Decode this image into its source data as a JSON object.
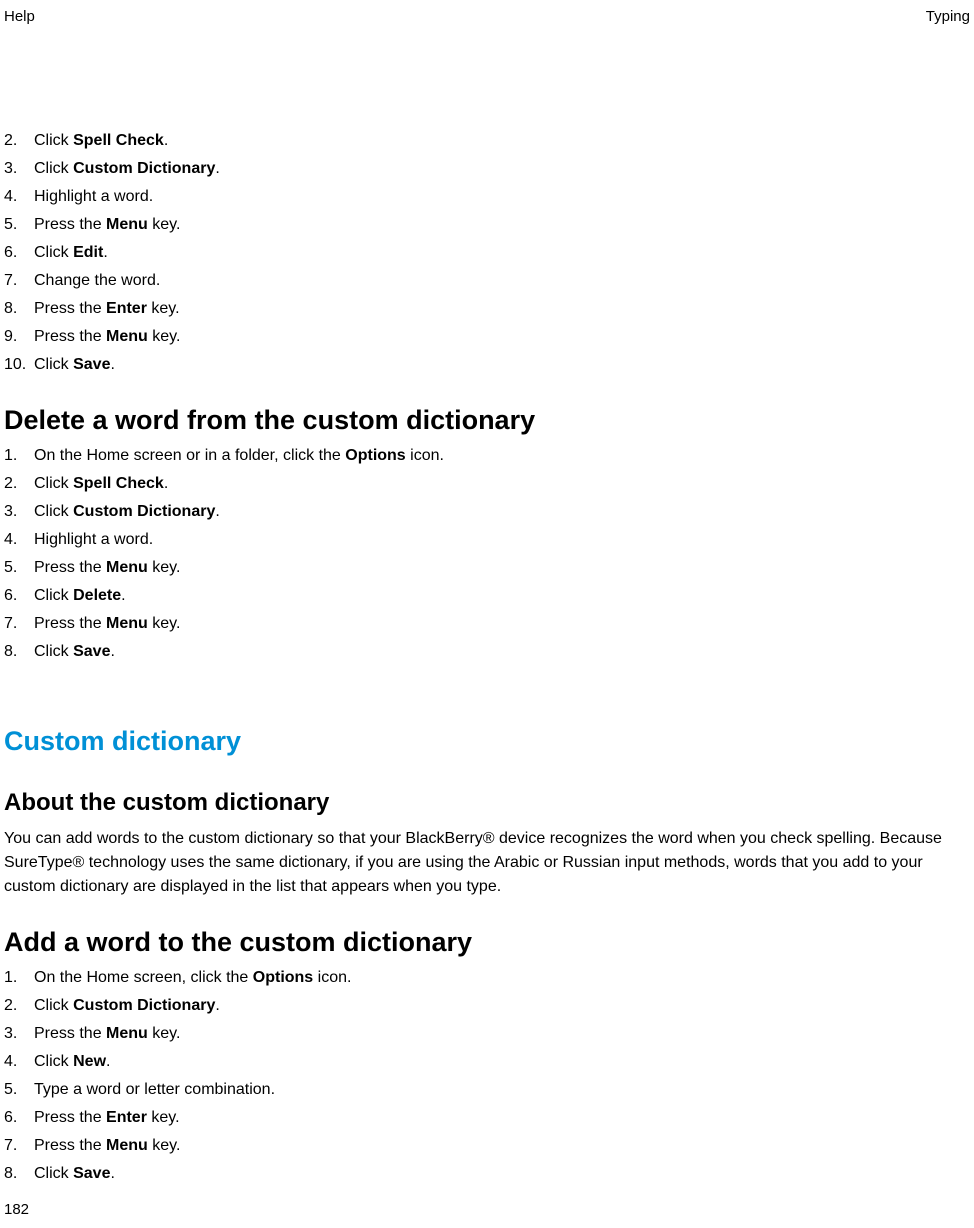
{
  "header": {
    "left": "Help",
    "right": "Typing"
  },
  "pageNumber": "182",
  "section1": {
    "steps": [
      {
        "n": "2.",
        "pre": "Click ",
        "bold": "Spell Check",
        "post": "."
      },
      {
        "n": "3.",
        "pre": "Click ",
        "bold": "Custom Dictionary",
        "post": "."
      },
      {
        "n": "4.",
        "pre": "Highlight a word.",
        "bold": "",
        "post": ""
      },
      {
        "n": "5.",
        "pre": "Press the ",
        "bold": "Menu",
        "post": " key."
      },
      {
        "n": "6.",
        "pre": "Click ",
        "bold": "Edit",
        "post": "."
      },
      {
        "n": "7.",
        "pre": "Change the word.",
        "bold": "",
        "post": ""
      },
      {
        "n": "8.",
        "pre": "Press the ",
        "bold": "Enter",
        "post": " key."
      },
      {
        "n": "9.",
        "pre": "Press the ",
        "bold": "Menu",
        "post": " key."
      },
      {
        "n": "10.",
        "pre": "Click ",
        "bold": "Save",
        "post": "."
      }
    ]
  },
  "section2": {
    "heading": "Delete a word from the custom dictionary",
    "steps": [
      {
        "n": "1.",
        "pre": "On the Home screen or in a folder, click the ",
        "bold": "Options",
        "post": " icon."
      },
      {
        "n": "2.",
        "pre": "Click ",
        "bold": "Spell Check",
        "post": "."
      },
      {
        "n": "3.",
        "pre": "Click ",
        "bold": "Custom Dictionary",
        "post": "."
      },
      {
        "n": "4.",
        "pre": "Highlight a word.",
        "bold": "",
        "post": ""
      },
      {
        "n": "5.",
        "pre": "Press the ",
        "bold": "Menu",
        "post": " key."
      },
      {
        "n": "6.",
        "pre": "Click ",
        "bold": "Delete",
        "post": "."
      },
      {
        "n": "7.",
        "pre": "Press the ",
        "bold": "Menu",
        "post": " key."
      },
      {
        "n": "8.",
        "pre": "Click ",
        "bold": "Save",
        "post": "."
      }
    ]
  },
  "section3": {
    "heading": "Custom dictionary"
  },
  "section4": {
    "heading": "About the custom dictionary",
    "body": "You can add words to the custom dictionary so that your BlackBerry® device recognizes the word when you check spelling. Because SureType® technology uses the same dictionary, if you are using the Arabic or Russian input methods, words that you add to your custom dictionary are displayed in the list that appears when you type."
  },
  "section5": {
    "heading": "Add a word to the custom dictionary",
    "steps": [
      {
        "n": "1.",
        "pre": "On the Home screen, click the ",
        "bold": "Options",
        "post": " icon."
      },
      {
        "n": "2.",
        "pre": "Click ",
        "bold": "Custom Dictionary",
        "post": "."
      },
      {
        "n": "3.",
        "pre": "Press the ",
        "bold": "Menu",
        "post": " key."
      },
      {
        "n": "4.",
        "pre": "Click ",
        "bold": "New",
        "post": "."
      },
      {
        "n": "5.",
        "pre": "Type a word or letter combination.",
        "bold": "",
        "post": ""
      },
      {
        "n": "6.",
        "pre": "Press the ",
        "bold": "Enter",
        "post": " key."
      },
      {
        "n": "7.",
        "pre": "Press the ",
        "bold": "Menu",
        "post": " key."
      },
      {
        "n": "8.",
        "pre": "Click ",
        "bold": "Save",
        "post": "."
      }
    ]
  }
}
